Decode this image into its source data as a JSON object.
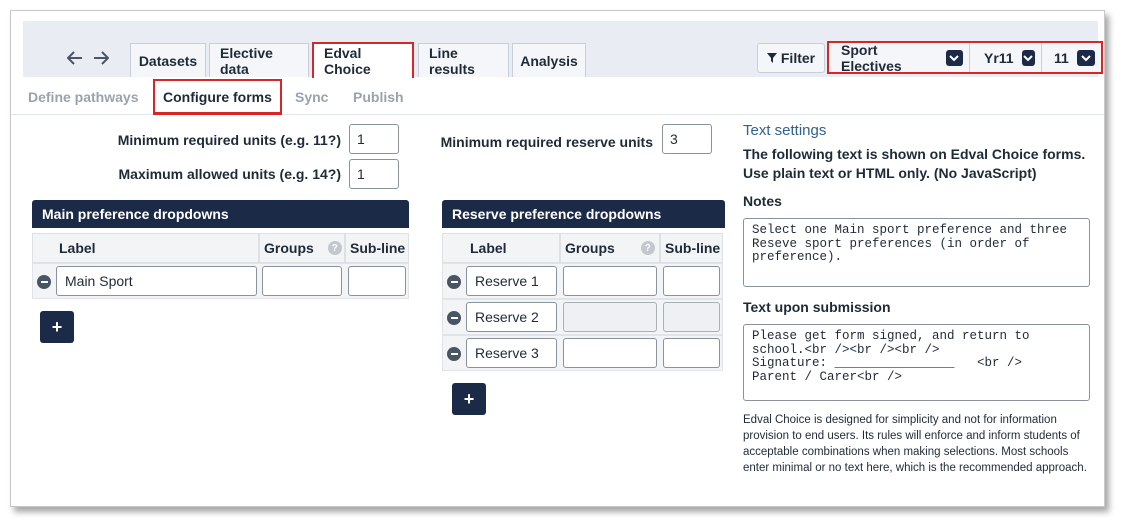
{
  "nav": {
    "back_icon": "arrow-left-icon",
    "forward_icon": "arrow-right-icon"
  },
  "tabs": [
    {
      "label": "Datasets"
    },
    {
      "label": "Elective data"
    },
    {
      "label": "Edval Choice"
    },
    {
      "label": "Line results"
    },
    {
      "label": "Analysis"
    }
  ],
  "filter": {
    "label": "Filter",
    "icon": "filter-icon"
  },
  "selectors": {
    "subject": "Sport Electives",
    "year": "Yr11",
    "group": "11"
  },
  "subtabs": [
    {
      "label": "Define pathways"
    },
    {
      "label": "Configure forms"
    },
    {
      "label": "Sync"
    },
    {
      "label": "Publish"
    }
  ],
  "units": {
    "min_label": "Minimum required units (e.g. 11?)",
    "min_value": "1",
    "max_label": "Maximum allowed units (e.g. 14?)",
    "max_value": "1",
    "reserve_label": "Minimum required reserve units",
    "reserve_value": "3"
  },
  "main_panel": {
    "title": "Main preference dropdowns",
    "headers": {
      "label": "Label",
      "groups": "Groups",
      "subline": "Sub-line"
    },
    "rows": [
      {
        "label": "Main Sport"
      }
    ],
    "add": "+"
  },
  "reserve_panel": {
    "title": "Reserve preference dropdowns",
    "headers": {
      "label": "Label",
      "groups": "Groups",
      "subline": "Sub-line"
    },
    "rows": [
      {
        "label": "Reserve 1"
      },
      {
        "label": "Reserve 2"
      },
      {
        "label": "Reserve 3"
      }
    ],
    "add": "+"
  },
  "text_settings": {
    "title": "Text settings",
    "description": "The following text is shown on Edval Choice forms. Use plain text or HTML only. (No JavaScript)",
    "notes_label": "Notes",
    "notes_value": "Select one Main sport preference and three\nReseve sport preferences (in order of\npreference).",
    "submission_label": "Text upon submission",
    "submission_value": "Please get form signed, and return to\nschool.<br /><br /><br />\nSignature: ________________   <br />\nParent / Carer<br />",
    "footnote": "Edval Choice is designed for simplicity and not for information provision to end users. Its rules will enforce and inform students of acceptable combinations when making selections. Most schools enter minimal or no text here, which is the recommended approach."
  },
  "colors": {
    "accent_dark": "#1b2a47",
    "highlight": "#d62728",
    "link_blue": "#33618c"
  }
}
